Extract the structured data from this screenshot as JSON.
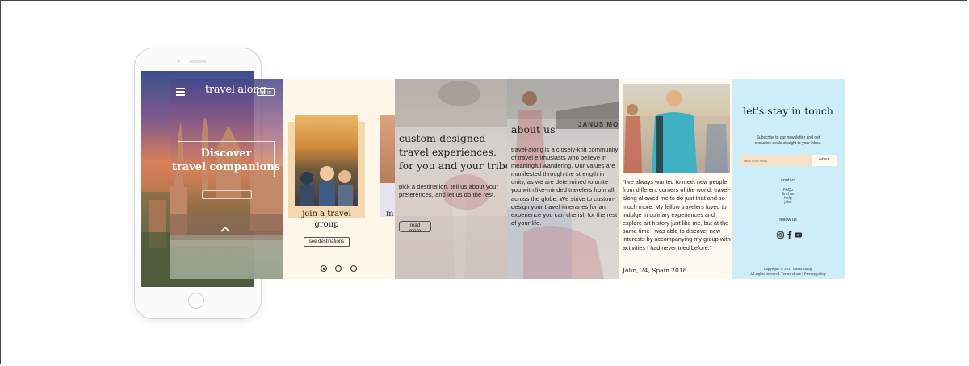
{
  "hero": {
    "logo": "travel along",
    "login": "log in",
    "headline_line1": "Discover",
    "headline_line2": "travel companions"
  },
  "carousel": {
    "card1_label_line1": "join a travel",
    "card1_label_line2": "group",
    "card2_label": "m",
    "button": "see destinations"
  },
  "custom": {
    "title_line1": "custom-designed",
    "title_line2": "travel experiences,",
    "title_line3": "for you and your tribe",
    "body": "pick a destination, tell us about your preferences, and let us do the rest.",
    "button_line1": "read",
    "button_line2": "more"
  },
  "about": {
    "title": "about us",
    "sign": "JANUS MO",
    "body": "travel-along is a closely-knit community of travel enthusiasts who believe in meaningful wandering. Our values are manifested through the strength in unity, as we are determined to unite you with like-minded travelers from all across the globe. We strive to custom-design your travel itineraries for an experience you can cherish for the rest of your life."
  },
  "testimonial": {
    "quote": "\"I've always wanted to meet new people from different corners of the world. travel-along allowed me to do just that and so much more. My fellow travelers loved to indulge in culinary experiences and explore art history just like me, but at the same time I was able to discover new interests by accompanying my group with activities I had never tried before.\"",
    "author": "John, 24, Spain 2018"
  },
  "contact": {
    "title": "let's stay in touch",
    "subtitle": "Subscribe to our newsletter and get exclusive deals straight to your inbox.",
    "email_placeholder": "enter your email",
    "submit": "submit",
    "contact_heading": "contact",
    "links": [
      "FAQs",
      "find us",
      "help",
      "jobs"
    ],
    "follow_heading": "follow us",
    "copyright_line1": "Copyright © 2021 travel.along.",
    "copyright_line2": "All rights reserved. Terms of use | Privacy policy"
  },
  "icons": {
    "menu": "menu-icon",
    "chevron": "chevron-up-icon",
    "instagram": "instagram-icon",
    "facebook": "facebook-icon",
    "youtube": "youtube-icon"
  },
  "colors": {
    "cream": "#fdf7ea",
    "light_blue": "#cdeef8",
    "card_peach": "#f6d8b0"
  }
}
